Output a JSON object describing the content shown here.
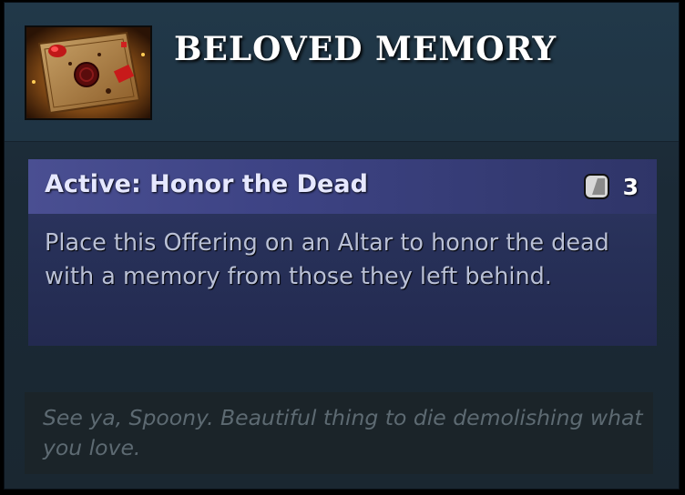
{
  "item": {
    "title": "BELOVED MEMORY",
    "icon": "offering-scroll-with-wax-seal-icon"
  },
  "ability": {
    "name": "Active: Honor the Dead",
    "charges": "3",
    "charge_icon": "charge-stone-icon",
    "description": "Place this Offering on an Altar to honor the dead with a memory from those they left behind."
  },
  "lore": {
    "text": "See ya, Spoony. Beautiful thing to die demolishing what you love."
  },
  "colors": {
    "ability_header": "#3d4384",
    "ability_body": "#273058",
    "title": "#ffffff",
    "lore_text": "#5d6a72"
  }
}
